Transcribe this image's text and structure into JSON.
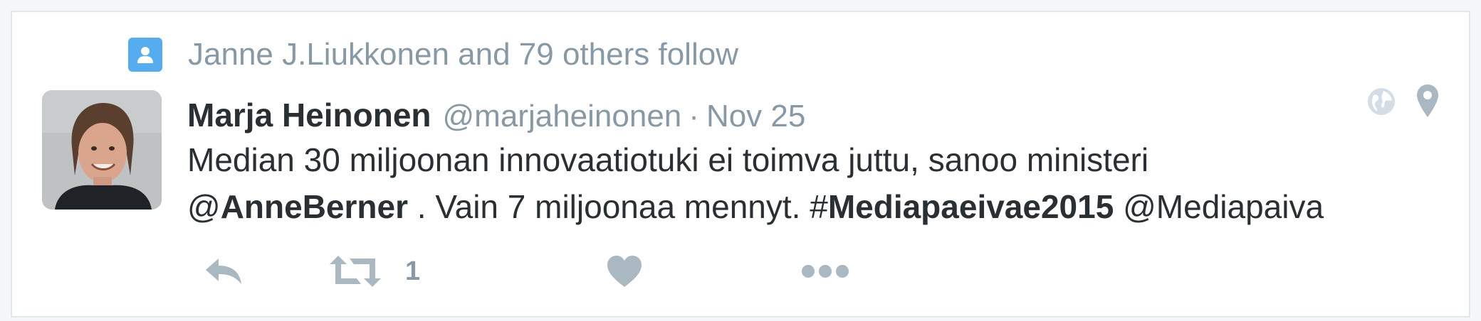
{
  "context": {
    "text": "Janne J.Liukkonen and 79 others follow",
    "icon": "person-icon"
  },
  "tweet": {
    "fullname": "Marja Heinonen",
    "username": "@marjaheinonen",
    "separator": "·",
    "timestamp": "Nov 25",
    "text": {
      "line1": "Median 30 miljoonan innovaatiotuki ei toimva juttu, sanoo ministeri",
      "mention_at": "@",
      "mention_name": "AnneBerner",
      "middle": " . Vain 7 miljoonaa mennyt. ",
      "hashtag_symbol": "#",
      "hashtag_name": "Mediapaeivae2015",
      "mention2": " @Mediapaiva"
    }
  },
  "actions": {
    "reply_icon": "reply-icon",
    "retweet_icon": "retweet-icon",
    "retweet_count": "1",
    "like_icon": "heart-icon",
    "more_icon": "more-dots-icon"
  },
  "colors": {
    "accent": "#55acee",
    "muted": "#8899a6",
    "text": "#292f33",
    "icon_gray": "#aab8c2"
  }
}
